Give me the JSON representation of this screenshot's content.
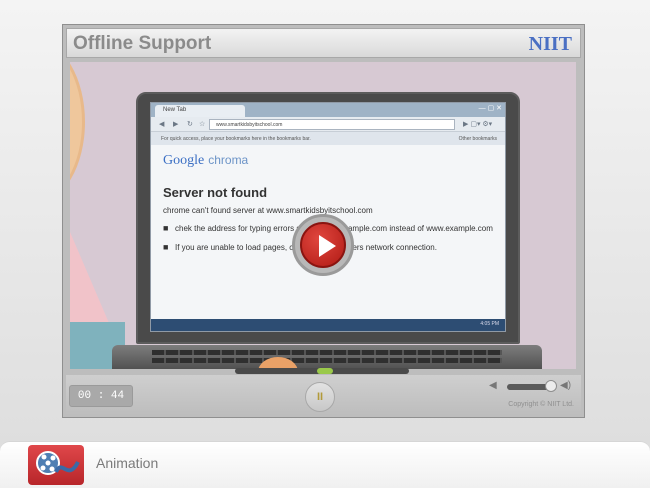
{
  "header": {
    "title": "Offline Support",
    "logo": "NIIT"
  },
  "browser": {
    "tab_label": "New Tab",
    "window_controls": "— ▢ ✕",
    "address": "www.smartkidsbyitschool.com",
    "bookmarks_hint": "For quick access, place your bookmarks here in the bookmarks bar.",
    "other_bookmarks": "Other bookmarks",
    "brand_google": "Google",
    "brand_chrome": "chroma",
    "error_title": "Server not found",
    "error_sub": "chrome can't found server at www.smartkidsbyitschool.com",
    "error_items": [
      "chek the address for typing errors such as ww.example.com instead of www.example.com",
      "If you are unable to load pages, chek your computers network connection."
    ],
    "tray_text": "4:05 PM"
  },
  "player": {
    "timer": "00 : 44",
    "pause_glyph": "II",
    "copyright": "Copyright © NIIT Ltd.",
    "play_button_icon": "play-icon",
    "volume_icon": "speaker-icon"
  },
  "bottom": {
    "label": "Animation",
    "icon": "film-reel-icon"
  },
  "colors": {
    "accent_red": "#c0302c",
    "seek_progress": "#9ac94a",
    "logo_blue": "#4a6fc3"
  }
}
